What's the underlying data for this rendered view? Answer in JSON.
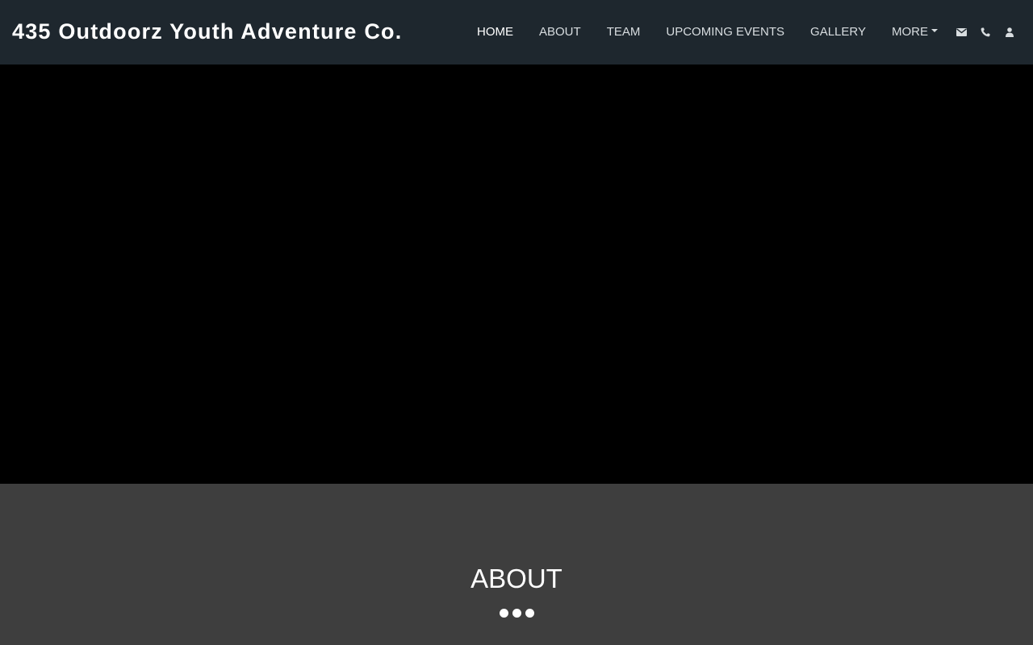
{
  "header": {
    "brand": "435 Outdoorz Youth Adventure Co.",
    "nav": [
      {
        "label": "HOME",
        "active": true
      },
      {
        "label": "ABOUT"
      },
      {
        "label": "TEAM"
      },
      {
        "label": "UPCOMING EVENTS"
      },
      {
        "label": "GALLERY"
      },
      {
        "label": "MORE"
      }
    ],
    "icons": [
      "envelope-icon",
      "phone-icon",
      "user-icon"
    ]
  },
  "about": {
    "title": "ABOUT"
  },
  "colors": {
    "navbar_bg": "#1e272e",
    "hero_bg": "#000000",
    "section_bg": "#3e3e3e",
    "text": "#ffffff"
  }
}
